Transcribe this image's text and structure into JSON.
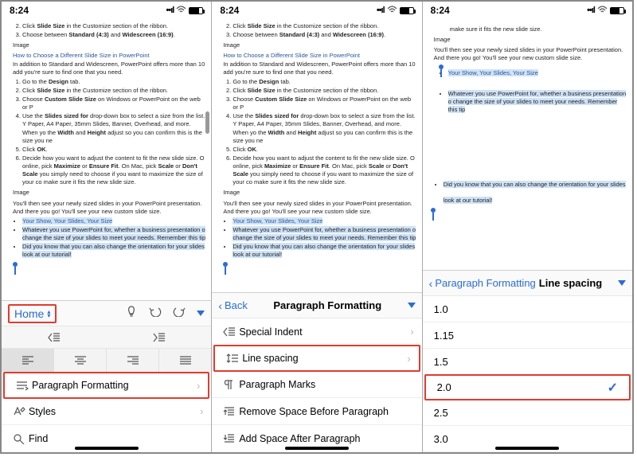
{
  "status": {
    "time": "8:24"
  },
  "doc": {
    "steps_top": [
      "Click <b>Slide Size</b> in the Customize section of the ribbon.",
      "Choose between <b>Standard (4:3)</b> and <b>Widescreen (16:9)</b>."
    ],
    "img_placeholder": "Image",
    "heading": "How to Choose a Different Slide Size in PowerPoint",
    "intro": "In addition to Standard and Widescreen, PowerPoint offers more than 10 add you're sure to find one that you need.",
    "steps": [
      "Go to the <b>Design</b> tab.",
      "Click <b>Slide Size</b> in the Customize section of the ribbon.",
      "Choose <b>Custom Slide Size</b> on Windows or PowerPoint on the web or P",
      "Use the <b>Slides sized for</b> drop-down box to select a size from the list. Y Paper, A4 Paper, 35mm Slides, Banner, Overhead, and more. When yo the <b>Width</b> and <b>Height</b> adjust so you can confirm this is the size you ne",
      "Click <b>OK</b>.",
      "Decide how you want to adjust the content to fit the new slide size. O online, pick <b>Maximize</b> or <b>Ensure Fit</b>. On Mac, pick <b>Scale</b> or <b>Don't Scale</b> you simply need to choose if you want to maximize the size of your co make sure it fits the new slide size."
    ],
    "after1": "You'll then see your newly sized slides in your PowerPoint presentation.",
    "after2": "And there you go! You'll see your new custom slide size.",
    "bullets": [
      "Your Show, Your Slides, Your Size",
      "Whatever you use PowerPoint for, whether a business presentation o change the size of your slides to meet your needs. Remember this tip",
      "Did you know that you can also change the orientation for your slides look at our tutorial!"
    ],
    "bullets_p3": [
      "Did you know that you can also change the orientation for your slides",
      "look at our tutorial!"
    ]
  },
  "phone1": {
    "ribbon_tab": "Home",
    "menu": {
      "paragraph": "Paragraph Formatting",
      "styles": "Styles",
      "find": "Find"
    }
  },
  "phone2": {
    "back": "Back",
    "title": "Paragraph Formatting",
    "items": {
      "special_indent": "Special Indent",
      "line_spacing": "Line spacing",
      "paragraph_marks": "Paragraph Marks",
      "remove_space": "Remove Space Before Paragraph",
      "add_space": "Add Space After Paragraph"
    }
  },
  "phone3": {
    "back": "Paragraph Formatting",
    "title": "Line spacing",
    "options": [
      "1.0",
      "1.15",
      "1.5",
      "2.0",
      "2.5",
      "3.0"
    ],
    "selected": "2.0"
  }
}
